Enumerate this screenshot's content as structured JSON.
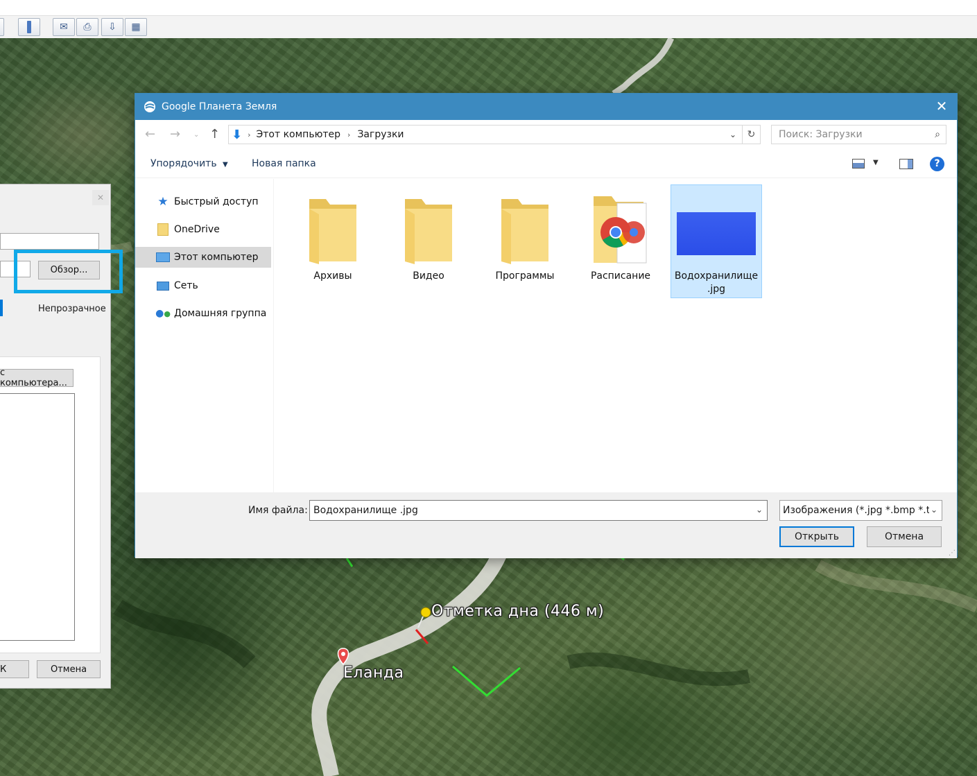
{
  "map": {
    "label_bottom": "Отметка дна (446 м)",
    "label_village": "Еланда"
  },
  "background_dialog": {
    "browse_button": "Обзор...",
    "opacity_label": "Непрозрачное",
    "from_computer_button": "с компьютера...",
    "ok_button_partial": "К",
    "cancel_button": "Отмена"
  },
  "dialog": {
    "title": "Google Планета Земля",
    "breadcrumb": [
      "Этот компьютер",
      "Загрузки"
    ],
    "search_placeholder": "Поиск: Загрузки",
    "organize": "Упорядочить",
    "new_folder": "Новая папка",
    "nav_items": [
      {
        "label": "Быстрый доступ",
        "icon": "star-icon"
      },
      {
        "label": "OneDrive",
        "icon": "folder-icon"
      },
      {
        "label": "Этот компьютер",
        "icon": "computer-icon"
      },
      {
        "label": "Сеть",
        "icon": "network-icon"
      },
      {
        "label": "Домашняя группа",
        "icon": "homegroup-icon"
      }
    ],
    "files": [
      {
        "name": "Архивы",
        "type": "folder"
      },
      {
        "name": "Видео",
        "type": "folder"
      },
      {
        "name": "Программы",
        "type": "folder"
      },
      {
        "name": "Расписание",
        "type": "chrome-folder"
      },
      {
        "name": "Водохранилище .jpg",
        "type": "image"
      }
    ],
    "filename_label": "Имя файла:",
    "filename_value": "Водохранилище .jpg",
    "filetype_value": "Изображения (*.jpg *.bmp *.ti",
    "open_button": "Открыть",
    "cancel_button": "Отмена"
  },
  "colors": {
    "titlebar": "#3c8ac0",
    "highlight": "#11a9e8",
    "selected_file": "#cce8ff"
  }
}
